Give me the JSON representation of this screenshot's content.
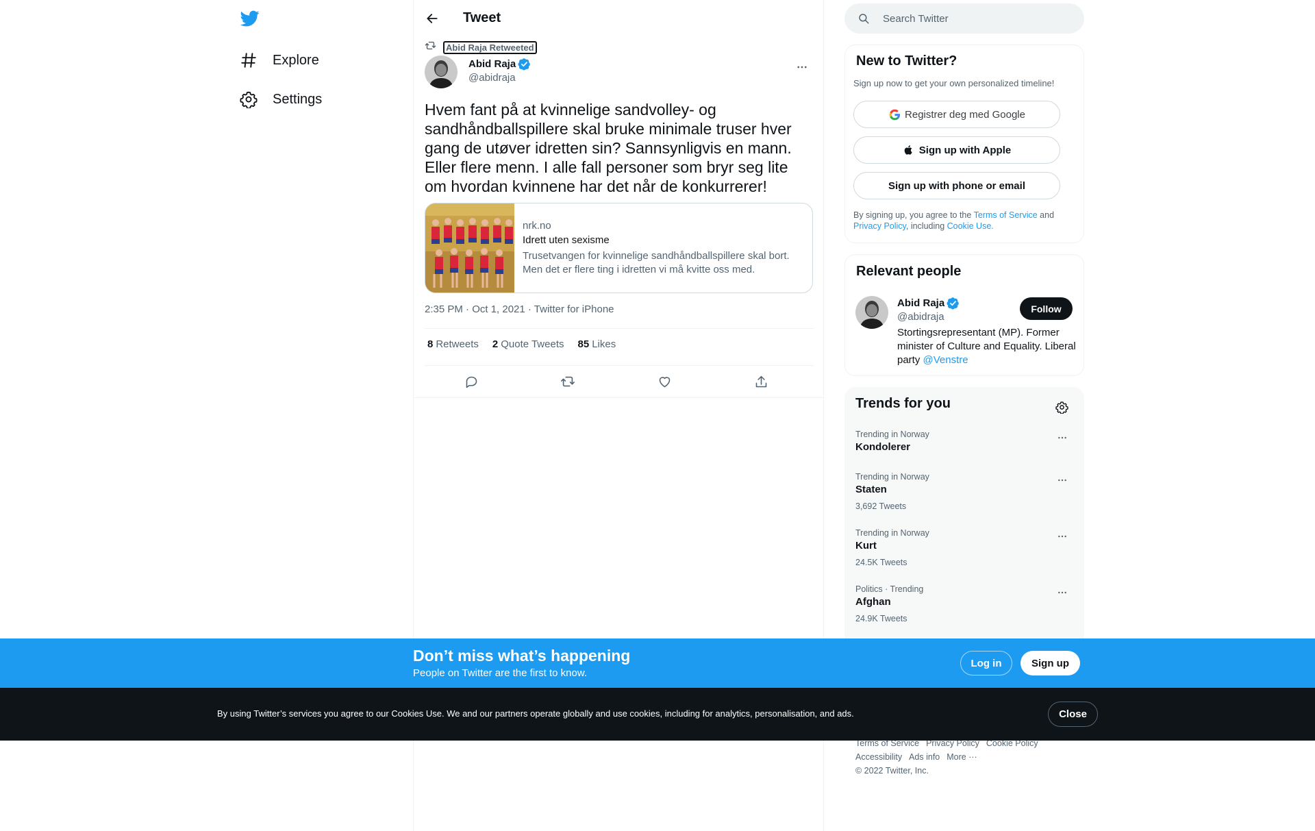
{
  "nav": {
    "explore_label": "Explore",
    "settings_label": "Settings",
    "icons": {
      "logo": "twitter-bird-icon",
      "explore": "hashtag-icon",
      "settings": "gear-icon"
    }
  },
  "header": {
    "title": "Tweet"
  },
  "tweet": {
    "retweeted_by": "Abid Raja Retweeted",
    "author_name": "Abid Raja",
    "author_handle": "@abidraja",
    "text": "Hvem fant på at kvinnelige sandvolley- og sandhåndballspillere skal bruke minimale truser hver gang de utøver idretten sin? Sannsynligvis en mann. Eller flere menn. I alle fall personer som bryr seg lite om hvordan kvinnene har det når de konkurrerer!",
    "card": {
      "domain": "nrk.no",
      "title": "Idrett uten sexisme",
      "description": "Trusetvangen for kvinnelige sandhåndballspillere skal bort. Men det er flere ting i idretten vi må kvitte oss med."
    },
    "timestamp": "2:35 PM · Oct 1, 2021 · Twitter for iPhone",
    "stats": {
      "retweets_num": "8",
      "retweets_label": "Retweets",
      "quotes_num": "2",
      "quotes_label": "Quote Tweets",
      "likes_num": "85",
      "likes_label": "Likes"
    }
  },
  "search": {
    "placeholder": "Search Twitter"
  },
  "new_to_twitter": {
    "title": "New to Twitter?",
    "subtitle": "Sign up now to get your own personalized timeline!",
    "google_label": "Registrer deg med Google",
    "apple_label": "Sign up with Apple",
    "phone_label": "Sign up with phone or email",
    "legal_prefix": "By signing up, you agree to the",
    "terms_link": "Terms of Service",
    "legal_and": "and",
    "privacy_link": "Privacy Policy",
    "legal_including": ", including",
    "cookie_link": "Cookie Use."
  },
  "relevant_people": {
    "title": "Relevant people",
    "name": "Abid Raja",
    "handle": "@abidraja",
    "follow_label": "Follow",
    "bio": "Stortingsrepresentant (MP). Former minister of Culture and Equality. Liberal party",
    "bio_link": "@Venstre"
  },
  "trends": {
    "title": "Trends for you",
    "items": [
      {
        "context": "Trending in Norway",
        "name": "Kondolerer",
        "count": ""
      },
      {
        "context": "Trending in Norway",
        "name": "Staten",
        "count": "3,692 Tweets"
      },
      {
        "context": "Trending in Norway",
        "name": "Kurt",
        "count": "24.5K Tweets"
      },
      {
        "context": "Politics · Trending",
        "name": "Afghan",
        "count": "24.9K Tweets"
      }
    ]
  },
  "footer": {
    "terms": "Terms of Service",
    "privacy": "Privacy Policy",
    "cookie": "Cookie Policy",
    "accessibility": "Accessibility",
    "ads": "Ads info",
    "more": "More ···",
    "copyright": "© 2022 Twitter, Inc."
  },
  "signup_bar": {
    "title": "Don’t miss what’s happening",
    "subtitle": "People on Twitter are the first to know.",
    "login_label": "Log in",
    "signup_label": "Sign up"
  },
  "cookie_bar": {
    "text": "By using Twitter’s services you agree to our Cookies Use. We and our partners operate globally and use cookies, including for analytics, personalisation, and ads.",
    "close_label": "Close"
  },
  "colors": {
    "accent": "#1d9bf0",
    "text": "#0f1419",
    "muted": "#536471",
    "cookie_bg": "#0f1419"
  }
}
